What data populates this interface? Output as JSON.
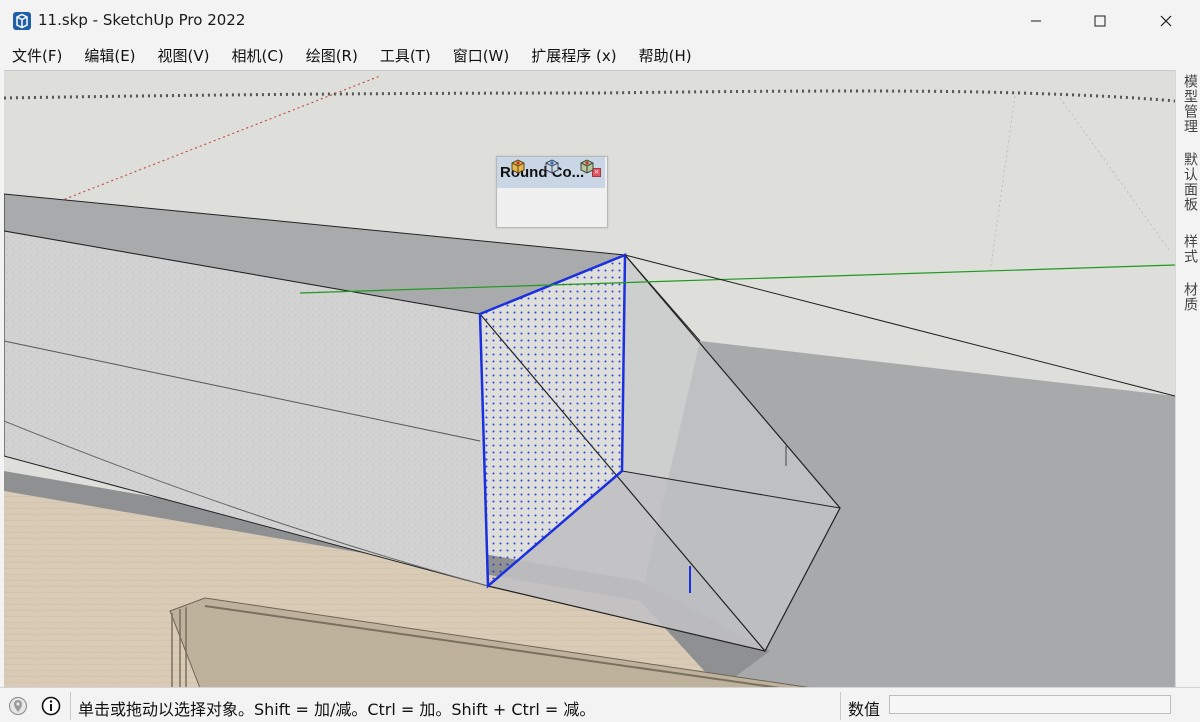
{
  "window": {
    "title": "11.skp - SketchUp Pro 2022",
    "controls": {
      "minimize": "—",
      "maximize": "☐",
      "close": "✕"
    }
  },
  "menu": [
    "文件(F)",
    "编辑(E)",
    "视图(V)",
    "相机(C)",
    "绘图(R)",
    "工具(T)",
    "窗口(W)",
    "扩展程序 (x)",
    "帮助(H)"
  ],
  "toolbar": {
    "title": "Round Co...",
    "close": "×",
    "tools": [
      "round-corner-tool-icon",
      "corner-tool-icon",
      "bevel-tool-icon"
    ]
  },
  "side_tabs": [
    "模型管理",
    "默认面板",
    "样式",
    "材质"
  ],
  "status": {
    "message": "单击或拖动以选择对象。Shift = 加/减。Ctrl = 加。Shift + Ctrl = 减。",
    "vcb_label": "数值",
    "vcb_value": ""
  },
  "colors": {
    "selection": "#1a2fe0",
    "green_axis": "#1f9a1f",
    "red_axis": "#c0392b",
    "background": "#dededa"
  }
}
